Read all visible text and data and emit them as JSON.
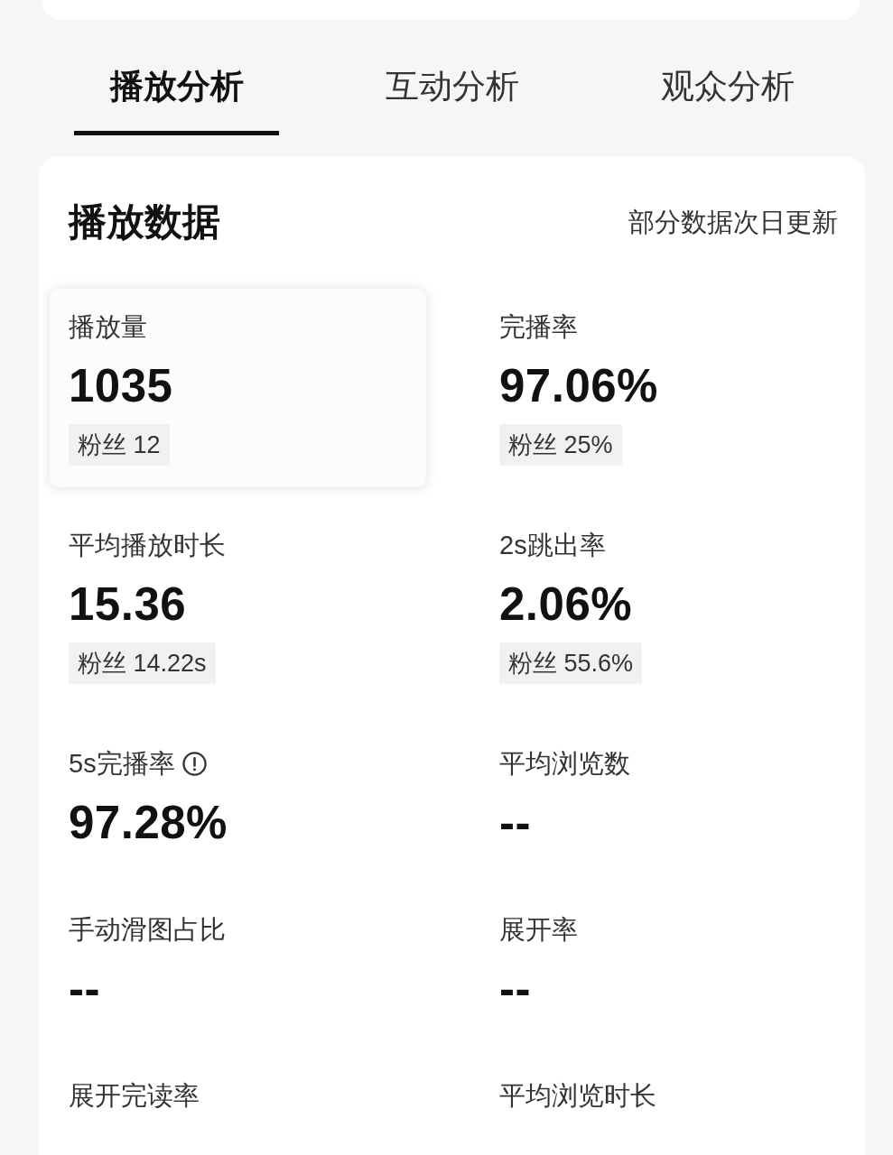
{
  "tabs": [
    {
      "label": "播放分析",
      "selected": true
    },
    {
      "label": "互动分析",
      "selected": false
    },
    {
      "label": "观众分析",
      "selected": false
    }
  ],
  "section": {
    "title": "播放数据",
    "note": "部分数据次日更新"
  },
  "metrics": [
    {
      "label": "播放量",
      "value": "1035",
      "fans": "粉丝 12",
      "selected": true,
      "info_icon": false
    },
    {
      "label": "完播率",
      "value": "97.06%",
      "fans": "粉丝 25%",
      "selected": false,
      "info_icon": false
    },
    {
      "label": "平均播放时长",
      "value": "15.36",
      "fans": "粉丝 14.22s",
      "selected": false,
      "info_icon": false
    },
    {
      "label": "2s跳出率",
      "value": "2.06%",
      "fans": "粉丝 55.6%",
      "selected": false,
      "info_icon": false
    },
    {
      "label": "5s完播率",
      "value": "97.28%",
      "selected": false,
      "info_icon": true
    },
    {
      "label": "平均浏览数",
      "value": "--",
      "selected": false,
      "info_icon": false
    },
    {
      "label": "手动滑图占比",
      "value": "--",
      "selected": false,
      "info_icon": false
    },
    {
      "label": "展开率",
      "value": "--",
      "selected": false,
      "info_icon": false
    },
    {
      "label": "展开完读率",
      "selected": false,
      "info_icon": false
    },
    {
      "label": "平均浏览时长",
      "selected": false,
      "info_icon": false
    }
  ]
}
